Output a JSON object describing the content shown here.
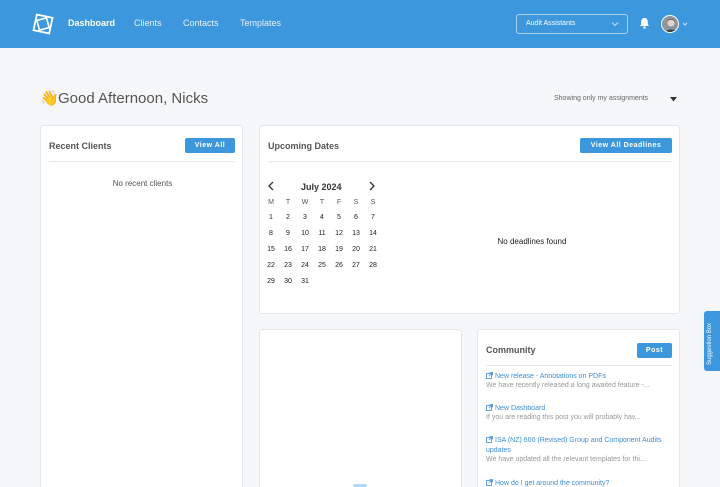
{
  "nav": {
    "items": [
      {
        "label": "Dashboard",
        "active": true
      },
      {
        "label": "Clients",
        "active": false
      },
      {
        "label": "Contacts",
        "active": false
      },
      {
        "label": "Templates",
        "active": false
      }
    ],
    "team_select": "Audit Assistants"
  },
  "greeting": {
    "emoji": "👋",
    "text": "Good Afternoon, Nicks"
  },
  "assignment_filter": "Showing only my assignments",
  "recent_clients": {
    "title": "Recent Clients",
    "button": "View All",
    "empty": "No recent clients"
  },
  "upcoming": {
    "title": "Upcoming Dates",
    "button": "View All Deadlines",
    "empty": "No deadlines found",
    "calendar": {
      "month": "July 2024",
      "weekdays": [
        "M",
        "T",
        "W",
        "T",
        "F",
        "S",
        "S"
      ],
      "weeks": [
        [
          "1",
          "2",
          "3",
          "4",
          "5",
          "6",
          "7"
        ],
        [
          "8",
          "9",
          "10",
          "11",
          "12",
          "13",
          "14"
        ],
        [
          "15",
          "16",
          "17",
          "18",
          "19",
          "20",
          "21"
        ],
        [
          "22",
          "23",
          "24",
          "25",
          "26",
          "27",
          "28"
        ],
        [
          "29",
          "30",
          "31",
          "",
          "",
          "",
          ""
        ]
      ]
    }
  },
  "community": {
    "title": "Community",
    "button": "Post",
    "posts": [
      {
        "title": "New release - Annotations on PDFs",
        "desc": "We have recently released a long awaited feature -..."
      },
      {
        "title": "New Dashboard",
        "desc": "If you are reading this post you will probably hav..."
      },
      {
        "title": "ISA (NZ) 600 (Revised) Group and Component Audits updates",
        "desc": "We have updated all the relevant templates for thi..."
      },
      {
        "title": "How do I get around the community?",
        "desc": ""
      }
    ]
  },
  "suggestion_box": "Suggestion Box",
  "colors": {
    "brand": "#3d97dc",
    "link": "#3d8ed6"
  }
}
